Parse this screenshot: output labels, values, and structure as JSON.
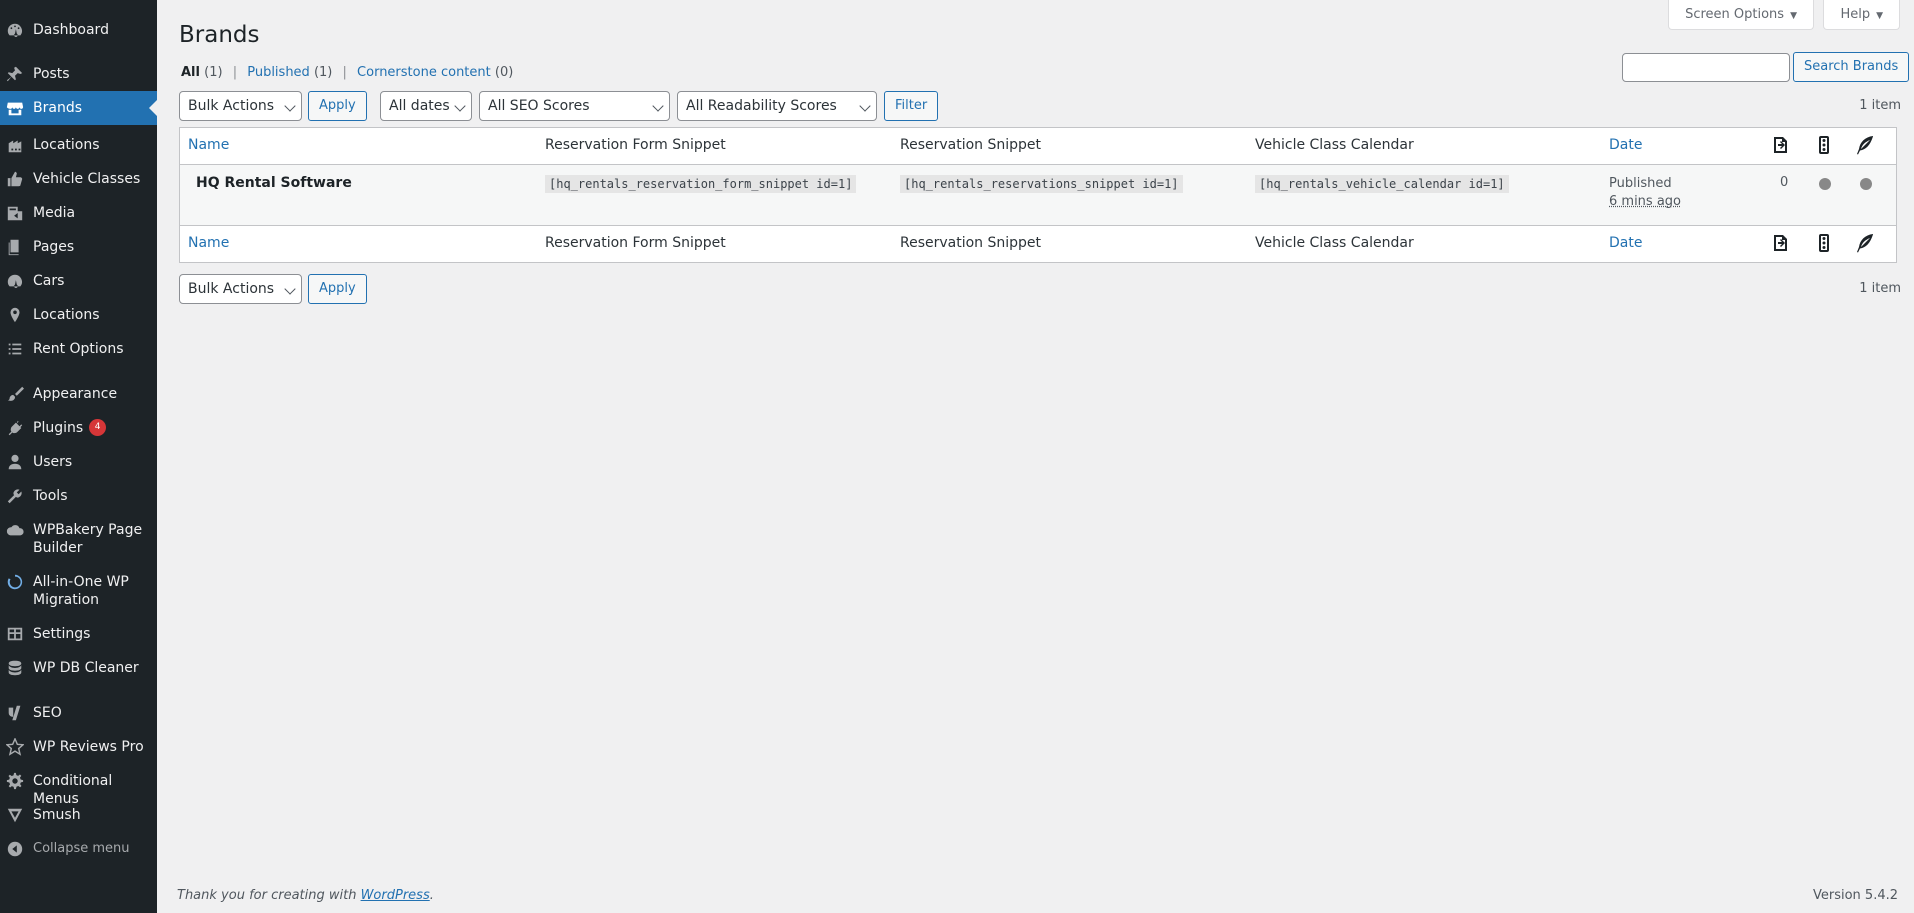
{
  "sidebar": {
    "items": [
      {
        "label": "Dashboard",
        "icon": "dashboard-icon"
      },
      {
        "label": "Posts",
        "icon": "pushpin-icon"
      },
      {
        "label": "Brands",
        "icon": "store-icon"
      },
      {
        "label": "Locations",
        "icon": "building-icon"
      },
      {
        "label": "Vehicle Classes",
        "icon": "thumbs-up-icon"
      },
      {
        "label": "Media",
        "icon": "media-icon"
      },
      {
        "label": "Pages",
        "icon": "pages-icon"
      },
      {
        "label": "Cars",
        "icon": "dashboard-icon"
      },
      {
        "label": "Locations",
        "icon": "location-pin-icon"
      },
      {
        "label": "Rent Options",
        "icon": "list-icon"
      },
      {
        "label": "Appearance",
        "icon": "brush-icon"
      },
      {
        "label": "Plugins",
        "icon": "plug-icon",
        "badge": "4"
      },
      {
        "label": "Users",
        "icon": "user-icon"
      },
      {
        "label": "Tools",
        "icon": "wrench-icon"
      },
      {
        "label": "WPBakery Page Builder",
        "icon": "cloud-icon"
      },
      {
        "label": "All-in-One WP Migration",
        "icon": "migration-icon"
      },
      {
        "label": "Settings",
        "icon": "settings-icon"
      },
      {
        "label": "WP DB Cleaner",
        "icon": "database-icon"
      },
      {
        "label": "SEO",
        "icon": "yoast-icon"
      },
      {
        "label": "WP Reviews Pro",
        "icon": "star-icon"
      },
      {
        "label": "Conditional Menus",
        "icon": "gear-icon"
      },
      {
        "label": "Smush",
        "icon": "smush-icon"
      },
      {
        "label": "Collapse menu",
        "icon": "collapse-icon"
      }
    ]
  },
  "header": {
    "screen_options": "Screen Options",
    "help": "Help",
    "title": "Brands"
  },
  "views": {
    "all": "All",
    "all_count": "(1)",
    "published": "Published",
    "published_count": "(1)",
    "cornerstone": "Cornerstone content",
    "cornerstone_count": "(0)",
    "separator": "|"
  },
  "search": {
    "value": "",
    "button": "Search Brands"
  },
  "toolbar": {
    "bulk_actions": "Bulk Actions",
    "apply": "Apply",
    "dates": "All dates",
    "seo_scores": "All SEO Scores",
    "readability_scores": "All Readability Scores",
    "filter": "Filter",
    "item_count": "1 item"
  },
  "table": {
    "columns": {
      "name": "Name",
      "reservation_form_snippet": "Reservation Form Snippet",
      "reservation_snippet": "Reservation Snippet",
      "vehicle_class_calendar": "Vehicle Class Calendar",
      "date": "Date"
    },
    "rows": [
      {
        "name": "HQ Rental Software",
        "reservation_form_snippet": "[hq_rentals_reservation_form_snippet id=1]",
        "reservation_snippet": "[hq_rentals_reservations_snippet id=1]",
        "vehicle_class_calendar": "[hq_rentals_vehicle_calendar id=1]",
        "status": "Published",
        "date": "6 mins ago",
        "links_count": "0"
      }
    ]
  },
  "footer": {
    "thanks_prefix": "Thank you for creating with ",
    "wordpress_link": "WordPress",
    "thanks_suffix": ".",
    "version": "Version 5.4.2"
  }
}
